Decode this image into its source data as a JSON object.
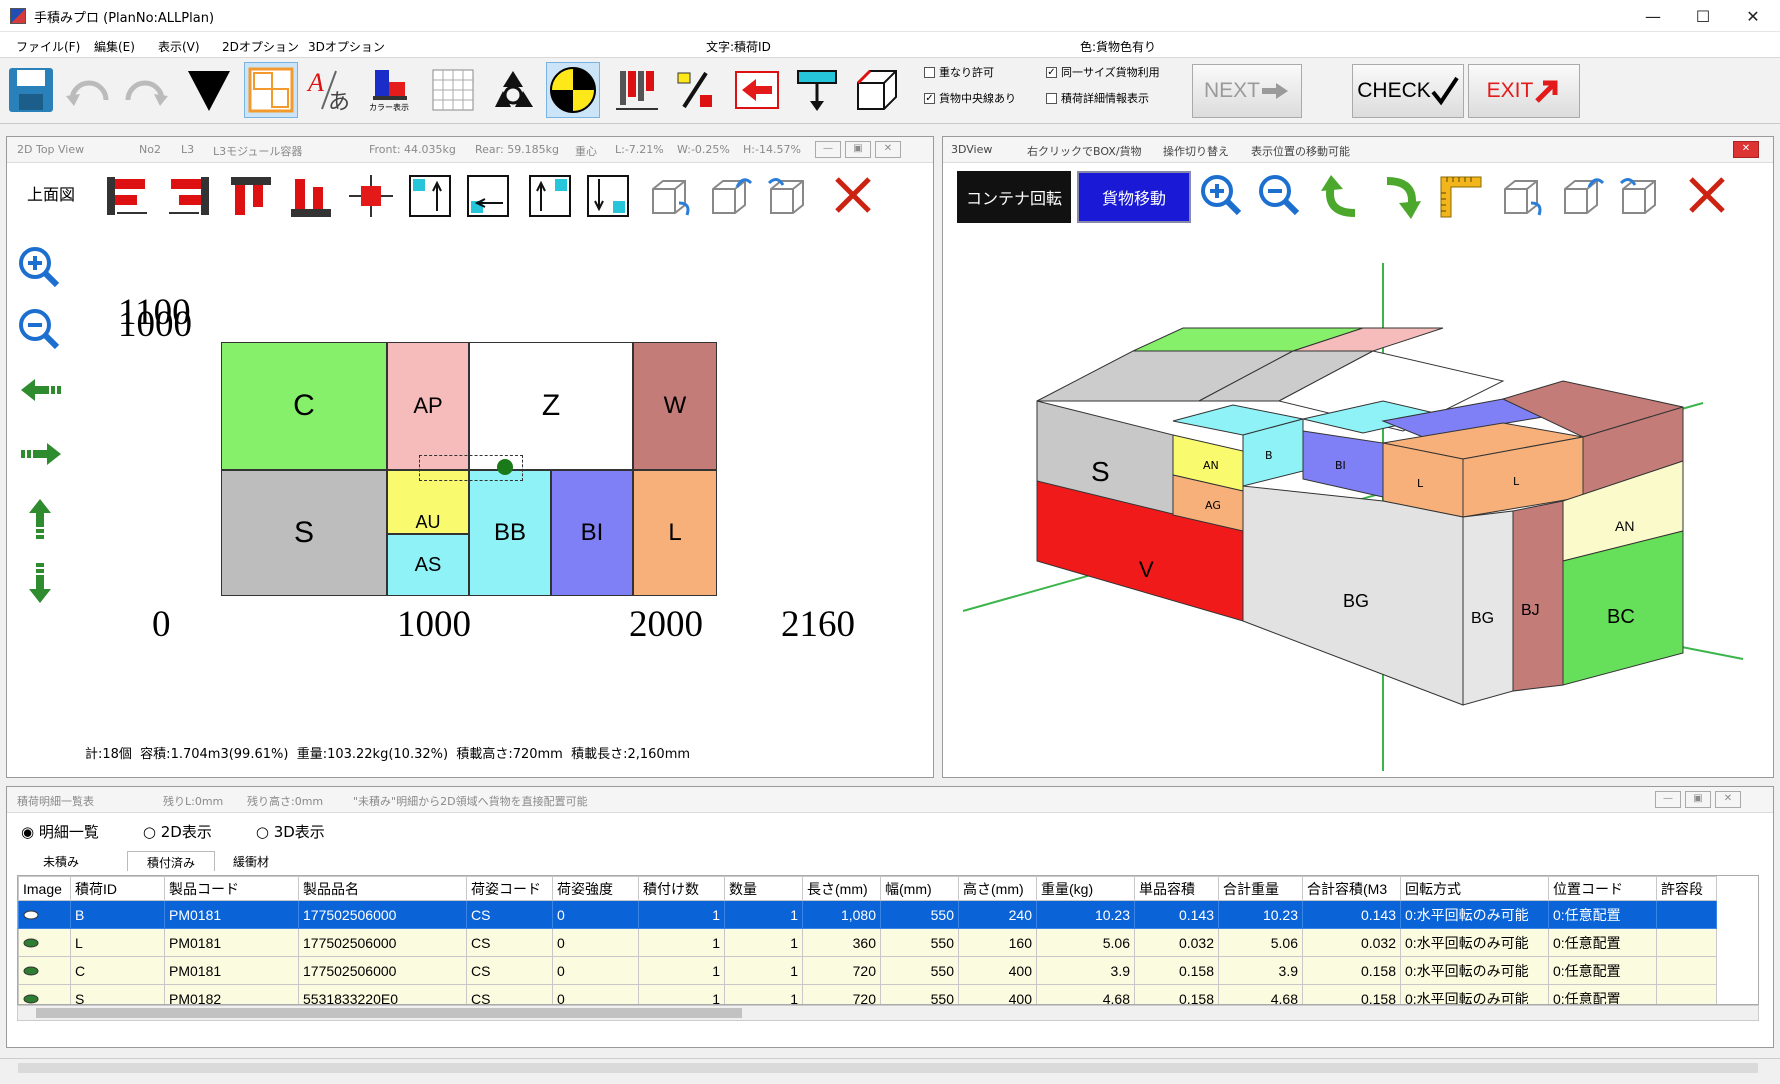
{
  "window": {
    "title": "手積みプロ (PlanNo:ALLPlan)"
  },
  "menu": {
    "items": [
      "ファイル(F)",
      "編集(E)",
      "表示(V)",
      "2Dオプション",
      "3Dオプション"
    ],
    "status_text": "文字:積荷ID",
    "status_color": "色:貨物色有り"
  },
  "toolbar": {
    "color_label": "カラー表示",
    "options": [
      "重なり許可",
      "同一サイズ貨物利用",
      "貨物中央線あり",
      "積荷詳細情報表示"
    ],
    "next": "NEXT",
    "check": "CHECK",
    "exit": "EXIT"
  },
  "topview": {
    "title": "2D Top View",
    "no": "No2",
    "l": "L3",
    "container": "L3モジュール容器",
    "front": "Front: 44.035kg",
    "rear": "Rear: 59.185kg",
    "cg": "重心",
    "lr": "L:-7.21%",
    "w": "W:-0.25%",
    "h": "H:-14.57%",
    "face_label": "上面図",
    "summary": "計:18個  容積:1.704m3(99.61%)  重量:103.22kg(10.32%)  積載高さ:720mm  積載長さ:2,160mm",
    "y_labels": [
      "1100",
      "1000"
    ],
    "x_labels": [
      "0",
      "1000",
      "2000",
      "2160"
    ],
    "blocks": [
      "C",
      "AP",
      "Z",
      "W",
      "S",
      "AU",
      "AS",
      "BB",
      "BI",
      "L"
    ]
  },
  "view3d": {
    "title": "3DView",
    "hint1": "右クリックでBOX/貨物",
    "hint2": "操作切り替え",
    "hint3": "表示位置の移動可能",
    "btn_rotate": "コンテナ回転",
    "btn_move": "貨物移動",
    "labels": [
      "S",
      "V",
      "AN",
      "AG",
      "B",
      "BI",
      "L",
      "BG",
      "BJ",
      "BC",
      "AN",
      "BG"
    ]
  },
  "detail": {
    "title": "積荷明細一覧表",
    "left": "残りL:0mm",
    "h": "残り高さ:0mm",
    "hint": "\"未積み\"明細から2D領域へ貨物を直接配置可能",
    "radios": [
      "明細一覧",
      "2D表示",
      "3D表示"
    ],
    "tabs": [
      "未積み",
      "積付済み",
      "緩衝材"
    ],
    "columns": [
      "Image",
      "積荷ID",
      "製品コード",
      "製品品名",
      "荷姿コード",
      "荷姿強度",
      "積付け数",
      "数量",
      "長さ(mm)",
      "幅(mm)",
      "高さ(mm)",
      "重量(kg)",
      "単品容積",
      "合計重量",
      "合計容積(M3",
      "回転方式",
      "位置コード",
      "許容段"
    ],
    "rows": [
      [
        "",
        "B",
        "PM0181",
        "177502506000",
        "CS",
        "0",
        "1",
        "1",
        "1,080",
        "550",
        "240",
        "10.23",
        "0.143",
        "10.23",
        "0.143",
        "0:水平回転のみ可能",
        "0:任意配置",
        ""
      ],
      [
        "",
        "L",
        "PM0181",
        "177502506000",
        "CS",
        "0",
        "1",
        "1",
        "360",
        "550",
        "160",
        "5.06",
        "0.032",
        "5.06",
        "0.032",
        "0:水平回転のみ可能",
        "0:任意配置",
        ""
      ],
      [
        "",
        "C",
        "PM0181",
        "177502506000",
        "CS",
        "0",
        "1",
        "1",
        "720",
        "550",
        "400",
        "3.9",
        "0.158",
        "3.9",
        "0.158",
        "0:水平回転のみ可能",
        "0:任意配置",
        ""
      ],
      [
        "",
        "S",
        "PM0182",
        "5531833220E0",
        "CS",
        "0",
        "1",
        "1",
        "720",
        "550",
        "400",
        "4.68",
        "0.158",
        "4.68",
        "0.158",
        "0:水平回転のみ可能",
        "0:任意配置",
        ""
      ]
    ]
  }
}
